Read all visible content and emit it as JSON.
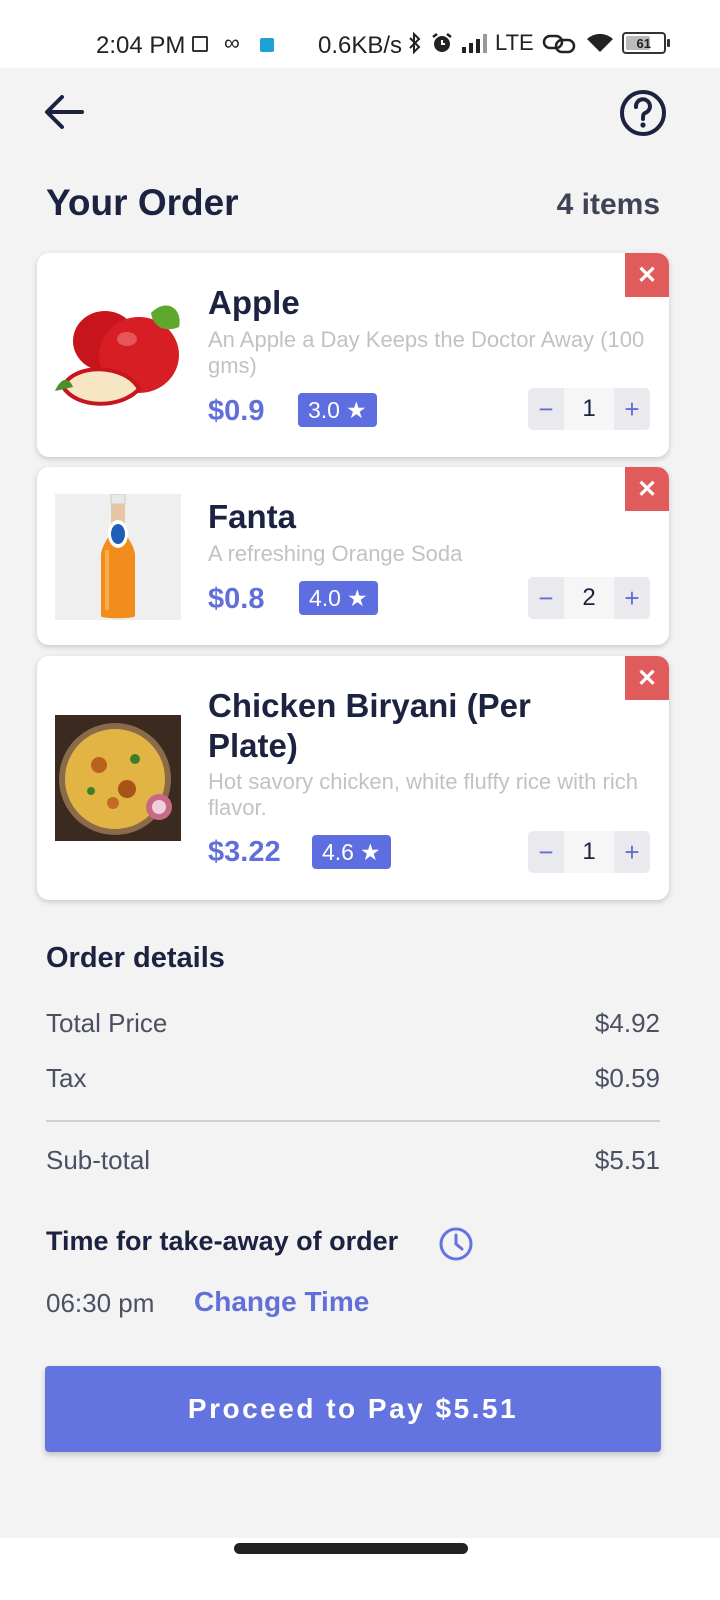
{
  "status_bar": {
    "time": "2:04 PM",
    "net_speed": "0.6KB/s",
    "infinity_glyph": "∞",
    "network": "LTE",
    "battery_level": "61"
  },
  "header": {
    "back_icon": "arrow-left-icon",
    "help_icon": "help-circle-icon",
    "title": "Your Order",
    "item_count": "4 items"
  },
  "items": [
    {
      "name": "Apple",
      "description": "An Apple a Day Keeps the Doctor Away (100 gms)",
      "price": "$0.9",
      "rating": "3.0",
      "quantity": "1",
      "image": "apple-image"
    },
    {
      "name": "Fanta",
      "description": "A refreshing Orange Soda",
      "price": "$0.8",
      "rating": "4.0",
      "quantity": "2",
      "image": "fanta-bottle-image"
    },
    {
      "name": "Chicken Biryani (Per Plate)",
      "description": "Hot savory chicken, white fluffy rice with rich flavor.",
      "price": "$3.22",
      "rating": "4.6",
      "quantity": "1",
      "image": "chicken-biryani-image"
    }
  ],
  "stepper": {
    "minus": "−",
    "plus": "+"
  },
  "rating_star": "★",
  "remove_glyph": "✕",
  "order_details": {
    "title": "Order details",
    "total_label": "Total Price",
    "total_value": "$4.92",
    "tax_label": "Tax",
    "tax_value": "$0.59",
    "subtotal_label": "Sub-total",
    "subtotal_value": "$5.51"
  },
  "takeaway": {
    "title": "Time for take-away of order",
    "time": "06:30 pm",
    "change_label": "Change Time",
    "clock_icon": "clock-icon"
  },
  "pay_button": {
    "label": "Proceed to Pay $5.51"
  },
  "colors": {
    "accent": "#6373df",
    "remove": "#e05b5b",
    "title": "#1c2340",
    "background": "#f3f3f3"
  }
}
